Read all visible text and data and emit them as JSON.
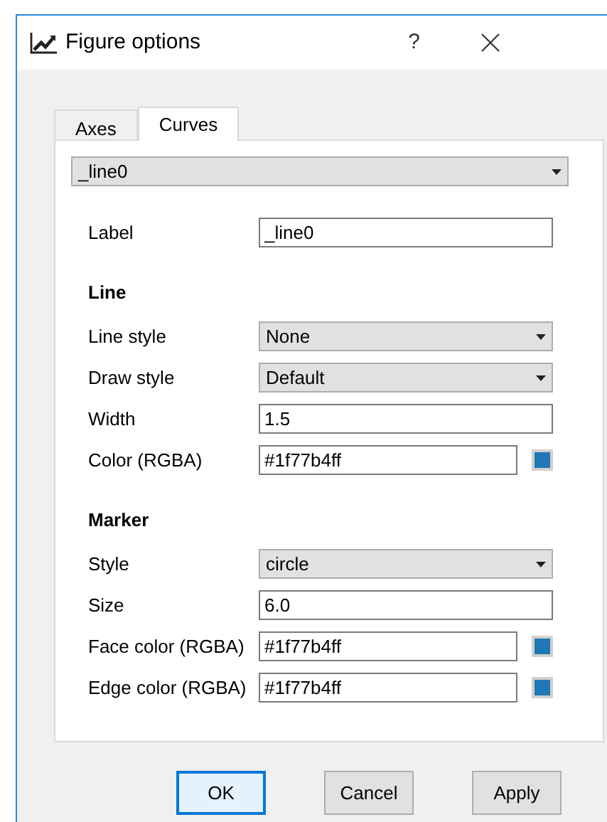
{
  "window": {
    "title": "Figure options",
    "help": "?"
  },
  "tabs": [
    {
      "label": "Axes",
      "selected": false
    },
    {
      "label": "Curves",
      "selected": true
    }
  ],
  "curve_select": {
    "value": "_line0"
  },
  "sections": [
    {
      "rows": [
        {
          "kind": "text",
          "label": "Label",
          "value": "_line0"
        }
      ]
    },
    {
      "header": "Line",
      "rows": [
        {
          "kind": "combo",
          "label": "Line style",
          "value": "None"
        },
        {
          "kind": "combo",
          "label": "Draw style",
          "value": "Default"
        },
        {
          "kind": "text",
          "label": "Width",
          "value": "1.5"
        },
        {
          "kind": "color",
          "label": "Color (RGBA)",
          "value": "#1f77b4ff",
          "color": "#1f77b4"
        }
      ]
    },
    {
      "header": "Marker",
      "rows": [
        {
          "kind": "combo",
          "label": "Style",
          "value": "circle"
        },
        {
          "kind": "text",
          "label": "Size",
          "value": "6.0"
        },
        {
          "kind": "color",
          "label": "Face color (RGBA)",
          "value": "#1f77b4ff",
          "color": "#1f77b4"
        },
        {
          "kind": "color",
          "label": "Edge color (RGBA)",
          "value": "#1f77b4ff",
          "color": "#1f77b4"
        }
      ]
    }
  ],
  "buttons": [
    {
      "label": "OK",
      "default": true
    },
    {
      "label": "Cancel",
      "default": false
    },
    {
      "label": "Apply",
      "default": false
    }
  ]
}
